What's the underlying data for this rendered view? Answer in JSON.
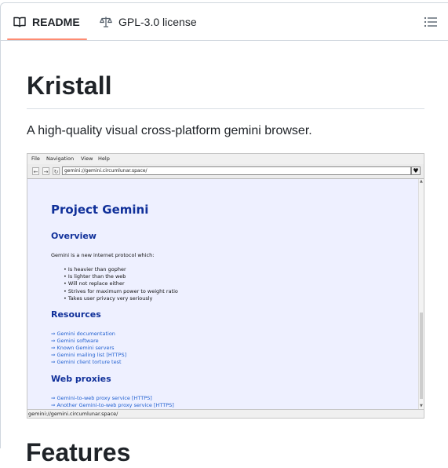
{
  "tabs": {
    "readme": "README",
    "license": "GPL-3.0 license"
  },
  "readme": {
    "title": "Kristall",
    "description": "A high-quality visual cross-platform gemini browser.",
    "next_heading": "Features"
  },
  "screenshot": {
    "menu": [
      "File",
      "Navigation",
      "View",
      "Help"
    ],
    "url": "gemini://gemini.circumlunar.space/",
    "status_url": "gemini://gemini.circumlunar.space/",
    "page": {
      "title": "Project Gemini",
      "overview_heading": "Overview",
      "intro": "Gemini is a new internet protocol which:",
      "bullets": [
        "Is heavier than gopher",
        "Is lighter than the web",
        "Will not replace either",
        "Strives for maximum power to weight ratio",
        "Takes user privacy very seriously"
      ],
      "resources_heading": "Resources",
      "resources": [
        "Gemini documentation",
        "Gemini software",
        "Known Gemini servers",
        "Gemini mailing list [HTTPS]",
        "Gemini client torture test"
      ],
      "proxies_heading": "Web proxies",
      "proxies": [
        "Gemini-to-web proxy service [HTTPS]",
        "Another Gemini-to-web proxy service [HTTPS]"
      ]
    }
  },
  "colors": {
    "tab_underline": "#fd8c73",
    "gemini_heading": "#10309a",
    "gemini_link": "#1f5fd0",
    "gemini_page_bg": "#eef0ff"
  },
  "icons": {
    "readme": "book-icon",
    "license": "law-scale-icon",
    "toc": "list-unordered-icon"
  }
}
